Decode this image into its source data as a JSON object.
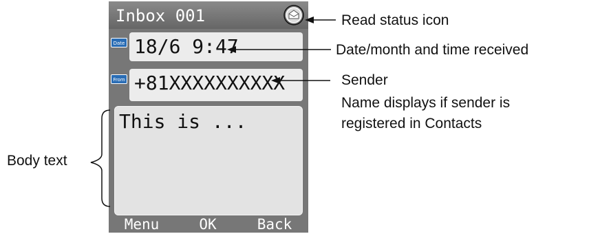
{
  "screen": {
    "title": "Inbox 001",
    "date_tag": "Date",
    "date": "18/6 9:47",
    "from_tag": "From",
    "sender": "+81XXXXXXXXXX",
    "body": "This is ...",
    "softkeys": [
      "Menu",
      "OK",
      "Back"
    ]
  },
  "icons": {
    "read_status": "envelope-icon",
    "date_tag": "date-tag-icon",
    "from_tag": "from-tag-icon"
  },
  "callouts": {
    "read_status": "Read status icon",
    "date_time": "Date/month and time received",
    "sender": "Sender",
    "sender_note_line1": "Name displays if sender is",
    "sender_note_line2": "registered in Contacts",
    "body_text": "Body text"
  },
  "colors": {
    "screen_bg": "#777777",
    "field_bg": "#ececec",
    "tag_blue": "#2a6db5"
  }
}
